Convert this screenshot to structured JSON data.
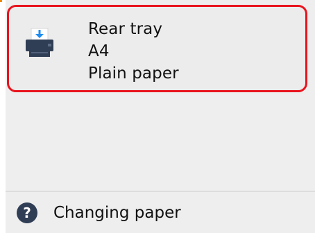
{
  "paper_source": {
    "lines": [
      "Rear tray",
      "A4",
      "Plain paper"
    ],
    "icon": "printer-rear-tray-icon",
    "highlight_color": "#e8141e"
  },
  "help_item": {
    "label": "Changing paper",
    "icon": "help-question-icon",
    "icon_color": "#2f3e55"
  }
}
